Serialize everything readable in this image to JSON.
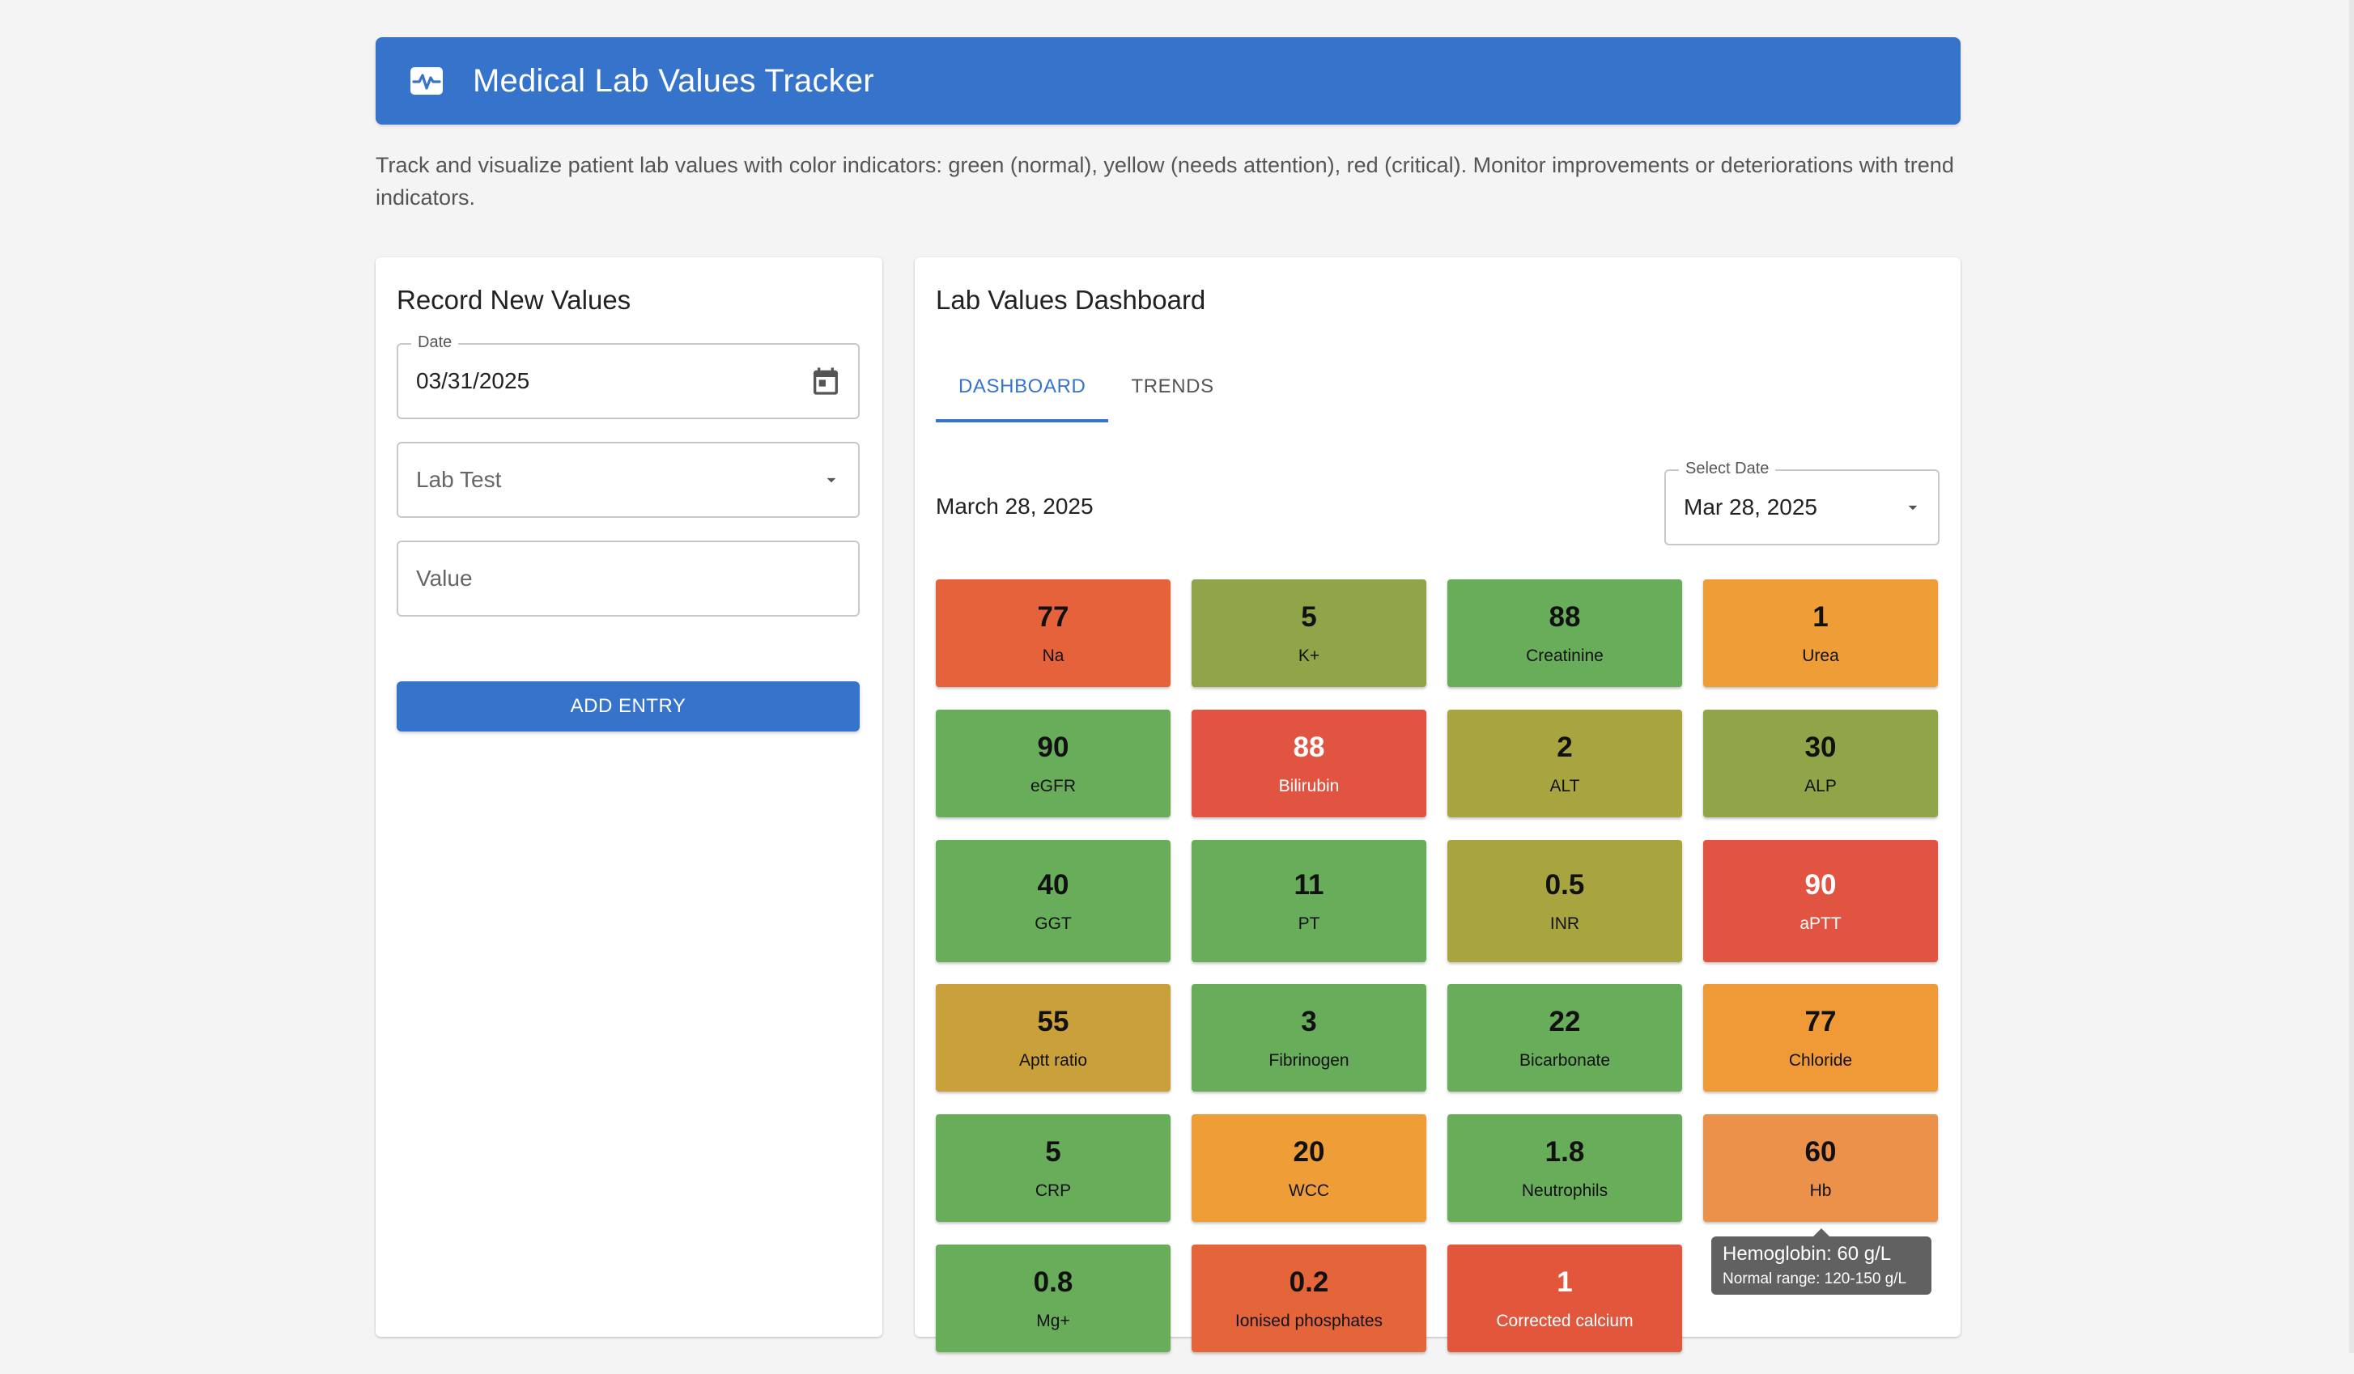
{
  "header": {
    "title": "Medical Lab Values Tracker",
    "icon": "monitor-heart-icon"
  },
  "description": "Track and visualize patient lab values with color indicators: green (normal), yellow (needs attention), red (critical). Monitor improvements or deteriorations with trend indicators.",
  "record_form": {
    "title": "Record New Values",
    "date_label": "Date",
    "date_value": "03/31/2025",
    "lab_test_placeholder": "Lab Test",
    "value_placeholder": "Value",
    "add_button": "ADD ENTRY"
  },
  "dashboard": {
    "title": "Lab Values Dashboard",
    "tabs": [
      {
        "label": "DASHBOARD",
        "active": true
      },
      {
        "label": "TRENDS",
        "active": false
      }
    ],
    "selected_date_text": "March 28, 2025",
    "select_date_label": "Select Date",
    "select_date_value": "Mar 28, 2025",
    "tiles": [
      {
        "value": "77",
        "name": "Na",
        "color": "#e5623a"
      },
      {
        "value": "5",
        "name": "K+",
        "color": "#8fa547"
      },
      {
        "value": "88",
        "name": "Creatinine",
        "color": "#68ad5a"
      },
      {
        "value": "1",
        "name": "Urea",
        "color": "#ef9d36"
      },
      {
        "value": "90",
        "name": "eGFR",
        "color": "#68ad5a"
      },
      {
        "value": "88",
        "name": "Bilirubin",
        "color": "#e25442",
        "light": true
      },
      {
        "value": "2",
        "name": "ALT",
        "color": "#a8a440"
      },
      {
        "value": "30",
        "name": "ALP",
        "color": "#8fa547"
      },
      {
        "value": "40",
        "name": "GGT",
        "color": "#68ad5a"
      },
      {
        "value": "11",
        "name": "PT",
        "color": "#68ad5a"
      },
      {
        "value": "0.5",
        "name": "INR",
        "color": "#a8a440"
      },
      {
        "value": "90",
        "name": "aPTT",
        "color": "#e25442",
        "light": true
      },
      {
        "value": "55",
        "name": "Aptt ratio",
        "color": "#c9a03a"
      },
      {
        "value": "3",
        "name": "Fibrinogen",
        "color": "#68ad5a"
      },
      {
        "value": "22",
        "name": "Bicarbonate",
        "color": "#68ad5a"
      },
      {
        "value": "77",
        "name": "Chloride",
        "color": "#ef9a36"
      },
      {
        "value": "5",
        "name": "CRP",
        "color": "#68ad5a"
      },
      {
        "value": "20",
        "name": "WCC",
        "color": "#ef9d36"
      },
      {
        "value": "1.8",
        "name": "Neutrophils",
        "color": "#68ad5a"
      },
      {
        "value": "60",
        "name": "Hb",
        "color": "#ec914a"
      },
      {
        "value": "0.8",
        "name": "Mg+",
        "color": "#68ad5a"
      },
      {
        "value": "0.2",
        "name": "Ionised phosphates",
        "color": "#e5653a"
      },
      {
        "value": "1",
        "name": "Corrected calcium",
        "color": "#e2573c",
        "light": true
      }
    ],
    "tooltip": {
      "title": "Hemoglobin: 60 g/L",
      "detail": "Normal range: 120-150 g/L"
    }
  }
}
